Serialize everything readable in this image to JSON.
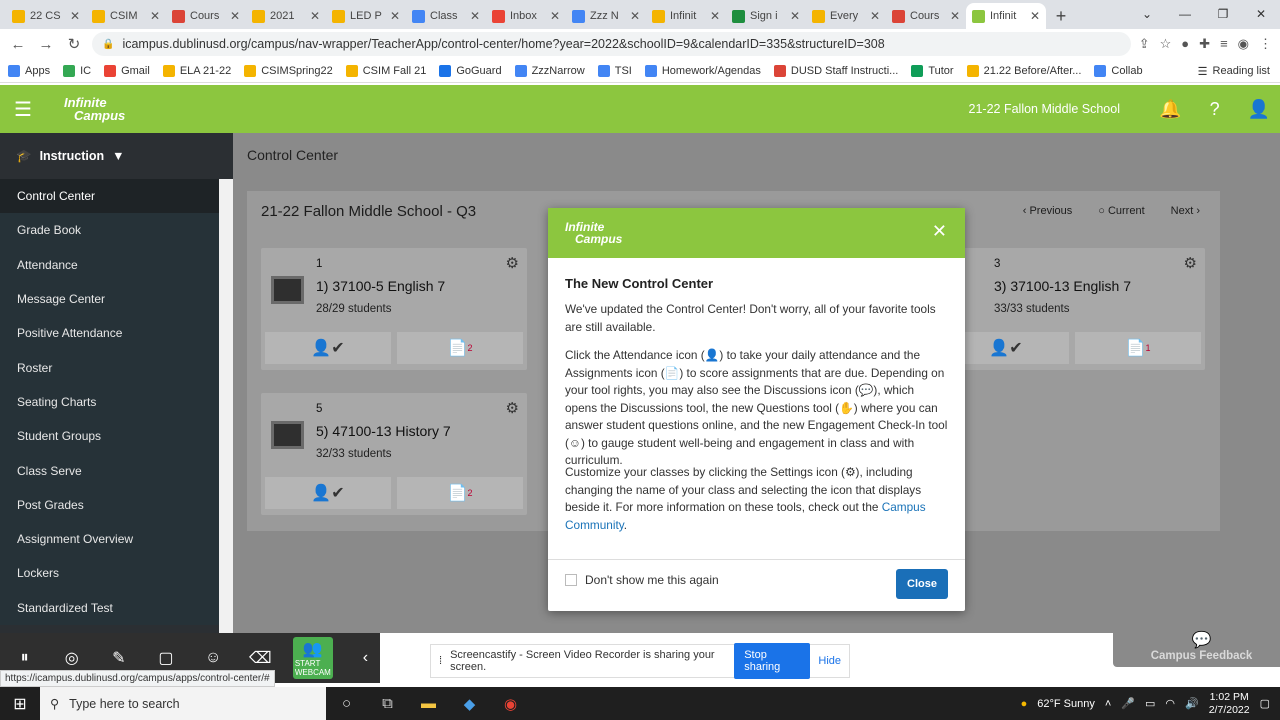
{
  "browser": {
    "tabs": [
      {
        "title": "22 CS",
        "color": "#f4b400"
      },
      {
        "title": "CSIM",
        "color": "#f4b400"
      },
      {
        "title": "Cours",
        "color": "#db4437"
      },
      {
        "title": "2021",
        "color": "#f4b400"
      },
      {
        "title": "LED P",
        "color": "#f4b400"
      },
      {
        "title": "Class",
        "color": "#4285f4"
      },
      {
        "title": "Inbox",
        "color": "#ea4335"
      },
      {
        "title": "Zzz N",
        "color": "#4285f4"
      },
      {
        "title": "Infinit",
        "color": "#f4b400"
      },
      {
        "title": "Sign i",
        "color": "#1e8e3e"
      },
      {
        "title": "Every",
        "color": "#f4b400"
      },
      {
        "title": "Cours",
        "color": "#db4437"
      },
      {
        "title": "Infinit",
        "color": "#8cc63f"
      }
    ],
    "url": "icampus.dublinusd.org/campus/nav-wrapper/TeacherApp/control-center/home?year=2022&schoolID=9&calendarID=335&structureID=308",
    "bookmarks": [
      "Apps",
      "IC",
      "Gmail",
      "ELA 21-22",
      "CSIMSpring22",
      "CSIM Fall 21",
      "GoGuard",
      "ZzzNarrow",
      "TSI",
      "Homework/Agendas",
      "DUSD Staff Instructi...",
      "Tutor",
      "21.22 Before/After...",
      "Collab"
    ],
    "reading_list": "Reading list"
  },
  "header": {
    "logo_line1": "Infinite",
    "logo_line2": "Campus",
    "school": "21-22 Fallon Middle School"
  },
  "sidebar": {
    "section": "Instruction",
    "items": [
      "Control Center",
      "Grade Book",
      "Attendance",
      "Message Center",
      "Positive Attendance",
      "Roster",
      "Seating Charts",
      "Student Groups",
      "Class Serve",
      "Post Grades",
      "Assignment Overview",
      "Lockers",
      "Standardized Test"
    ]
  },
  "main": {
    "title": "Control Center",
    "panel_title": "21-22 Fallon Middle School - Q3",
    "nav": {
      "previous": "Previous",
      "current": "Current",
      "next": "Next"
    },
    "cards": [
      {
        "num": "1",
        "name": "1) 37100-5 English 7",
        "students": "28/29 students",
        "assign_badge": "2"
      },
      {
        "num": "3",
        "name": "3) 37100-13 English 7",
        "students": "33/33 students",
        "assign_badge": "1"
      },
      {
        "num": "5",
        "name": "5) 47100-13 History 7",
        "students": "32/33 students",
        "assign_badge": "2"
      }
    ]
  },
  "modal": {
    "logo_line1": "Infinite",
    "logo_line2": "Campus",
    "title": "The New Control Center",
    "p1": "We've updated the Control Center! Don't worry, all of your favorite tools are still available.",
    "p2": "Click the Attendance icon (👤) to take your daily attendance and the Assignments icon (📄) to score assignments that are due. Depending on your tool rights, you may also see the Discussions icon (💬), which opens the Discussions tool, the new Questions tool (✋) where you can answer student questions online, and the new Engagement Check-In tool (☺) to gauge student well-being and engagement in class and with curriculum.",
    "p3": "Customize your classes by clicking the Settings icon (⚙), including changing the name of your class and selecting the icon that displays beside it. For more information on these tools, check out the",
    "link": "Campus Community",
    "checkbox": "Don't show me this again",
    "close": "Close"
  },
  "feedback": "Campus Feedback",
  "screencastify": {
    "msg": "Screencastify - Screen Video Recorder is sharing your screen.",
    "stop": "Stop sharing",
    "hide": "Hide"
  },
  "tools": [
    "Pause",
    "Mouse",
    "Pen",
    "Rectangle",
    "Stickers",
    "Eraser",
    "START WEBCAM"
  ],
  "status_url": "https://icampus.dublinusd.org/campus/apps/control-center/#",
  "taskbar": {
    "search": "Type here to search",
    "weather": "62°F  Sunny",
    "time": "1:02 PM",
    "date": "2/7/2022"
  }
}
